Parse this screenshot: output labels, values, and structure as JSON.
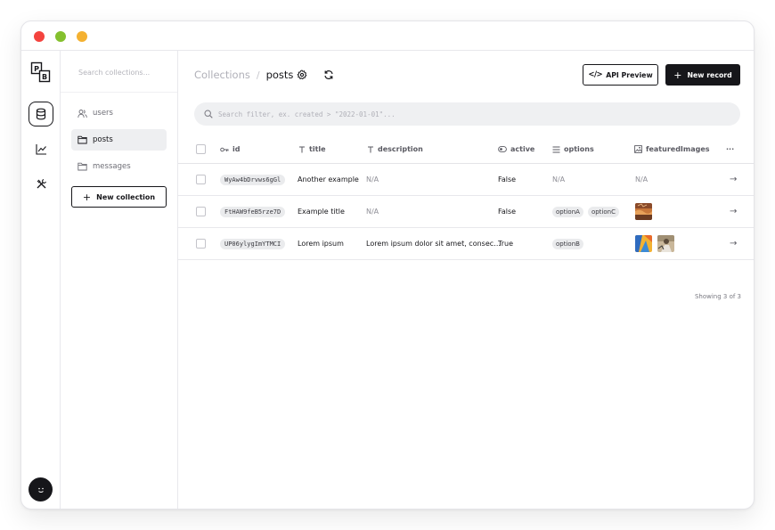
{
  "sidebar": {
    "search_placeholder": "Search collections...",
    "items": [
      {
        "label": "users",
        "icon": "users-icon"
      },
      {
        "label": "posts",
        "icon": "folder-icon"
      },
      {
        "label": "messages",
        "icon": "folder-icon"
      }
    ],
    "new_collection_label": "New collection"
  },
  "rail": {
    "logo_letters": [
      "P",
      "B"
    ],
    "items": [
      "database-icon",
      "chart-icon",
      "tools-icon"
    ],
    "active": "database-icon"
  },
  "header": {
    "breadcrumb_root": "Collections",
    "breadcrumb_sep": "/",
    "breadcrumb_current": "posts",
    "api_preview_label": "API Preview",
    "new_record_label": "New record"
  },
  "search": {
    "placeholder": "Search filter, ex. created > \"2022-01-01\"..."
  },
  "table": {
    "columns": [
      {
        "label": "id",
        "icon": "key-icon"
      },
      {
        "label": "title",
        "icon": "text-icon"
      },
      {
        "label": "description",
        "icon": "text-icon"
      },
      {
        "label": "active",
        "icon": "toggle-icon"
      },
      {
        "label": "options",
        "icon": "list-icon"
      },
      {
        "label": "featuredImages",
        "icon": "image-icon"
      }
    ],
    "more_label": "···",
    "rows": [
      {
        "id": "WyAw4bDrvws6gGl",
        "title": "Another example",
        "description": "N/A",
        "active": "False",
        "options_text": "N/A",
        "images_text": "N/A"
      },
      {
        "id": "FtHAW9feB5rze7D",
        "title": "Example title",
        "description": "N/A",
        "active": "False",
        "options": [
          "optionA",
          "optionC"
        ]
      },
      {
        "id": "UP06ylygImYTMCI",
        "title": "Lorem ipsum",
        "description": "Lorem ipsum dolor sit amet, consec…",
        "active": "True",
        "options": [
          "optionB"
        ]
      }
    ],
    "footer": "Showing 3 of 3"
  },
  "colors": {
    "dot_red": "#f4433e",
    "dot_green": "#84c02e",
    "dot_yellow": "#f4b131",
    "primary": "#16161a"
  }
}
